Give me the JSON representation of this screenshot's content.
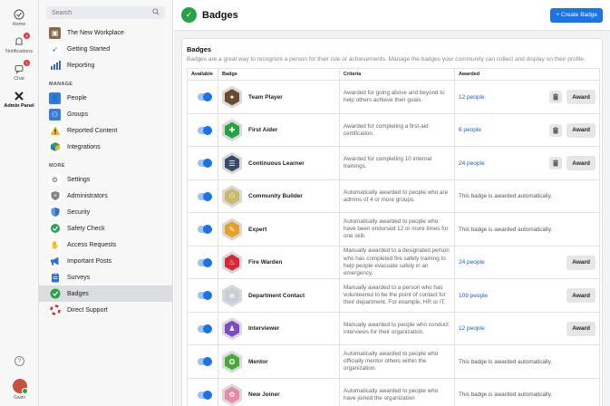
{
  "rail": {
    "items": [
      {
        "label": "Home",
        "icon": "home-icon"
      },
      {
        "label": "Notifications",
        "icon": "bell-icon",
        "count": "4"
      },
      {
        "label": "Chat",
        "icon": "chat-icon",
        "count": "1"
      },
      {
        "label": "Admin Panel",
        "icon": "admin-icon"
      }
    ],
    "help": "?",
    "user": "Gwen"
  },
  "sidebar": {
    "search_placeholder": "Search",
    "top_items": [
      "The New Workplace",
      "Getting Started",
      "Reporting"
    ],
    "manage_header": "MANAGE",
    "manage_items": [
      "People",
      "Groups",
      "Reported Content",
      "Integrations"
    ],
    "more_header": "MORE",
    "more_items": [
      "Settings",
      "Administrators",
      "Security",
      "Safety Check",
      "Access Requests",
      "Important Posts",
      "Surveys",
      "Badges",
      "Direct Support"
    ]
  },
  "header": {
    "title": "Badges",
    "create_label": "+ Create Badge"
  },
  "panel": {
    "title": "Badges",
    "description": "Badges are a great way to recognize a person for their role or achievements. Manage the badges your community can collect and display on their profile.",
    "columns": [
      "Available",
      "Badge",
      "Criteria",
      "Awarded"
    ],
    "award_label": "Award",
    "rows": [
      {
        "name": "Team Player",
        "criteria": "Awarded for going above and beyond to help others achieve their goals.",
        "awarded": "12 people",
        "auto": false,
        "deletable": true,
        "color": "#6b4b2f"
      },
      {
        "name": "First Aider",
        "criteria": "Awarded for completing a first-aid certification.",
        "awarded": "6 people",
        "auto": false,
        "deletable": true,
        "color": "#27a243"
      },
      {
        "name": "Continuous Learner",
        "criteria": "Awarded for completing 10 internal trainings.",
        "awarded": "24 people",
        "auto": false,
        "deletable": true,
        "color": "#3b4a6b"
      },
      {
        "name": "Community Builder",
        "criteria": "Automatically awarded to people who are admins of 4 or more groups.",
        "awarded": "This badge is awarded automatically.",
        "auto": true,
        "deletable": false,
        "color": "#c9b96a"
      },
      {
        "name": "Expert",
        "criteria": "Automatically awarded to people who have been endorsed 12 or more times for one skill.",
        "awarded": "This badge is awarded automatically.",
        "auto": true,
        "deletable": false,
        "color": "#e4a12b"
      },
      {
        "name": "Fire Warden",
        "criteria": "Manually awarded to a designated person who has completed fire safety training to help people evacuate safely in an emergency.",
        "awarded": "24 people",
        "auto": false,
        "deletable": false,
        "color": "#d6283b"
      },
      {
        "name": "Department Contact",
        "criteria": "Manually awarded to a person who has volunteered to be the point of contact for their department. For example, HR or IT.",
        "awarded": "109 people",
        "auto": false,
        "deletable": false,
        "color": "#c9ced6"
      },
      {
        "name": "Interviewer",
        "criteria": "Manually awarded to people who conduct interviews for their organization.",
        "awarded": "12 people",
        "auto": false,
        "deletable": false,
        "color": "#7a4cc9"
      },
      {
        "name": "Mentor",
        "criteria": "Automatically awarded to people who officially mentor others within the organization.",
        "awarded": "This badge is awarded automatically.",
        "auto": true,
        "deletable": false,
        "color": "#4aa83a"
      },
      {
        "name": "New Joiner",
        "criteria": "Automatically awarded to people who have joined the organization",
        "awarded": "This badge is awarded automatically.",
        "auto": true,
        "deletable": false,
        "color": "#e889a8"
      }
    ]
  }
}
